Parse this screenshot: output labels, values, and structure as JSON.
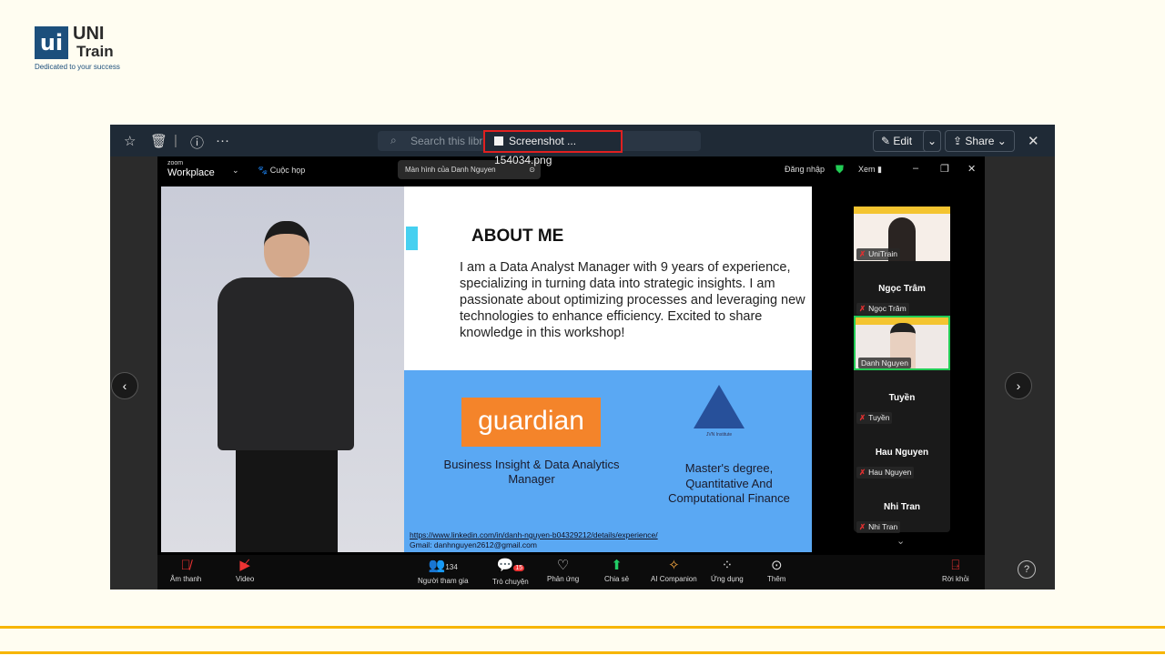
{
  "brand": {
    "mark": "ui",
    "name_top": "UNI",
    "name_bottom": "Train",
    "tagline": "Dedicated to your success"
  },
  "viewer": {
    "file_name": "Screenshot ... 154034.png",
    "edit_label": "Edit",
    "share_label": "Share",
    "search_placeholder": "Search this library"
  },
  "zoom": {
    "logo_small": "zoom",
    "logo_big": "Workplace",
    "meetings": "Cuộc họp",
    "screen_share": "Màn hình của Danh Nguyen",
    "sign_in": "Đăng nhập",
    "view": "Xem"
  },
  "slide": {
    "title": "ABOUT ME",
    "bio": "I am a Data Analyst Manager with 9 years of experience, specializing in turning data into strategic insights. I am passionate about optimizing processes and leveraging new technologies to enhance efficiency. Excited to share knowledge in this workshop!",
    "company_logo": "guardian",
    "role": "Business Insight & Data Analytics Manager",
    "institute": "JVN Institute",
    "degree": "Master's degree, Quantitative And Computational Finance",
    "linkedin": "https://www.linkedin.com/in/danh-nguyen-b04329212/details/experience/",
    "gmail": "Gmail: danhnguyen2612@gmail.com"
  },
  "participants": [
    {
      "tile": "",
      "label": "UniTrain",
      "video": true
    },
    {
      "tile": "Ngọc Trâm",
      "label": "Ngọc Trâm",
      "video": false
    },
    {
      "tile": "",
      "label": "Danh Nguyen",
      "video": true,
      "speaking": true
    },
    {
      "tile": "Tuyền",
      "label": "Tuyền",
      "video": false
    },
    {
      "tile": "Hau Nguyen",
      "label": "Hau Nguyen",
      "video": false
    },
    {
      "tile": "Nhi Tran",
      "label": "Nhi Tran",
      "video": false
    }
  ],
  "toolbar": {
    "audio": "Âm thanh",
    "video": "Video",
    "participants": "Người tham gia",
    "participants_count": "134",
    "chat": "Trò chuyện",
    "chat_badge": "15",
    "reactions": "Phản ứng",
    "share": "Chia sẻ",
    "ai": "AI Companion",
    "apps": "Ứng dụng",
    "more": "Thêm",
    "leave": "Rời khỏi"
  },
  "colors": {
    "accent_line": "#f7b500",
    "highlight": "#e02020",
    "speaking": "#22cc55",
    "share": "#22cc66"
  }
}
